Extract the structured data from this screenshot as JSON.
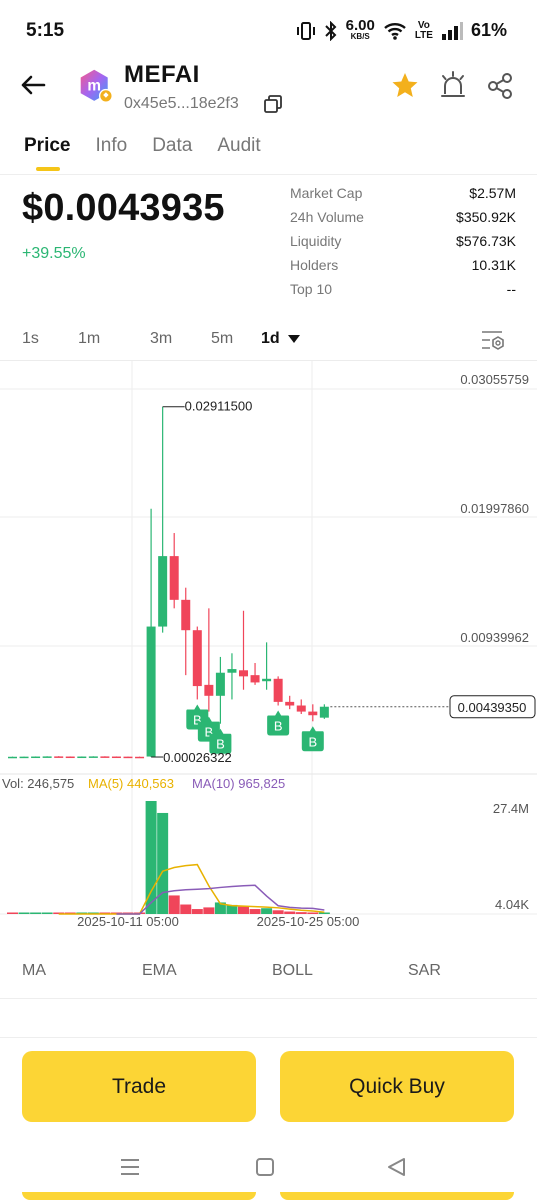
{
  "status_bar": {
    "time": "5:15",
    "net_speed_value": "6.00",
    "net_speed_unit": "KB/S",
    "volte_top": "Vo",
    "volte_bottom": "LTE",
    "battery": "61%"
  },
  "header": {
    "token_name": "MEFAI",
    "address": "0x45e5...18e2f3",
    "icons": [
      "back-arrow-icon",
      "token-logo-icon",
      "copy-icon",
      "star-icon",
      "alert-bell-icon",
      "share-icon"
    ]
  },
  "tabs": [
    {
      "label": "Price",
      "active": true
    },
    {
      "label": "Info",
      "active": false
    },
    {
      "label": "Data",
      "active": false
    },
    {
      "label": "Audit",
      "active": false
    }
  ],
  "price": {
    "value": "$0.0043935",
    "change": "+39.55%"
  },
  "stats": [
    {
      "label": "Market Cap",
      "value": "$2.57M"
    },
    {
      "label": "24h Volume",
      "value": "$350.92K"
    },
    {
      "label": "Liquidity",
      "value": "$576.73K"
    },
    {
      "label": "Holders",
      "value": "10.31K"
    },
    {
      "label": "Top 10",
      "value": "--"
    }
  ],
  "intervals": [
    "1s",
    "1m",
    "3m",
    "5m",
    "1d"
  ],
  "selected_interval": "1d",
  "colors": {
    "up": "#2bb673",
    "down": "#f0455a",
    "accent": "#fcd535",
    "ma5": "#e8b200",
    "ma10": "#8a5cb8"
  },
  "chart_data": {
    "type": "candlestick",
    "price_axis_labels": [
      "0.03055759",
      "0.01997860",
      "0.00939962"
    ],
    "current_price_label": "0.00439350",
    "high_annotation": "0.02911500",
    "low_annotation": "0.00026322",
    "candles": [
      {
        "o": 0.00027,
        "h": 0.00029,
        "l": 0.00026,
        "c": 0.00028
      },
      {
        "o": 0.00028,
        "h": 0.0003,
        "l": 0.00027,
        "c": 0.00029
      },
      {
        "o": 0.00029,
        "h": 0.00031,
        "l": 0.00028,
        "c": 0.0003
      },
      {
        "o": 0.0003,
        "h": 0.00032,
        "l": 0.00029,
        "c": 0.00031
      },
      {
        "o": 0.00031,
        "h": 0.00033,
        "l": 0.0003,
        "c": 0.0003
      },
      {
        "o": 0.0003,
        "h": 0.00031,
        "l": 0.00029,
        "c": 0.00029
      },
      {
        "o": 0.00029,
        "h": 0.00031,
        "l": 0.00028,
        "c": 0.0003
      },
      {
        "o": 0.0003,
        "h": 0.00032,
        "l": 0.00029,
        "c": 0.00031
      },
      {
        "o": 0.00031,
        "h": 0.00032,
        "l": 0.00029,
        "c": 0.0003
      },
      {
        "o": 0.0003,
        "h": 0.00031,
        "l": 0.00028,
        "c": 0.00029
      },
      {
        "o": 0.00029,
        "h": 0.0003,
        "l": 0.00027,
        "c": 0.00028
      },
      {
        "o": 0.00028,
        "h": 0.00029,
        "l": 0.00026,
        "c": 0.00027
      },
      {
        "o": 0.0003,
        "h": 0.0207,
        "l": 0.00026,
        "c": 0.011
      },
      {
        "o": 0.011,
        "h": 0.0291,
        "l": 0.0105,
        "c": 0.0168
      },
      {
        "o": 0.0168,
        "h": 0.0187,
        "l": 0.0125,
        "c": 0.0132
      },
      {
        "o": 0.0132,
        "h": 0.0142,
        "l": 0.007,
        "c": 0.0107
      },
      {
        "o": 0.0107,
        "h": 0.011,
        "l": 0.005,
        "c": 0.0061
      },
      {
        "o": 0.0062,
        "h": 0.0125,
        "l": 0.004,
        "c": 0.0053
      },
      {
        "o": 0.0053,
        "h": 0.0085,
        "l": 0.003,
        "c": 0.0072
      },
      {
        "o": 0.0072,
        "h": 0.0088,
        "l": 0.005,
        "c": 0.0075
      },
      {
        "o": 0.0074,
        "h": 0.0123,
        "l": 0.0058,
        "c": 0.0069
      },
      {
        "o": 0.007,
        "h": 0.008,
        "l": 0.0062,
        "c": 0.0064
      },
      {
        "o": 0.0065,
        "h": 0.0097,
        "l": 0.0058,
        "c": 0.0067
      },
      {
        "o": 0.0067,
        "h": 0.0069,
        "l": 0.0045,
        "c": 0.0048
      },
      {
        "o": 0.0048,
        "h": 0.0053,
        "l": 0.0042,
        "c": 0.0045
      },
      {
        "o": 0.0045,
        "h": 0.005,
        "l": 0.0038,
        "c": 0.004
      },
      {
        "o": 0.004,
        "h": 0.0046,
        "l": 0.0032,
        "c": 0.0037
      },
      {
        "o": 0.0035,
        "h": 0.0046,
        "l": 0.0034,
        "c": 0.0044
      }
    ],
    "buy_markers": [
      {
        "candle": 16,
        "label": "B"
      },
      {
        "candle": 17,
        "label": "B"
      },
      {
        "candle": 18,
        "label": "B"
      },
      {
        "candle": 23,
        "label": "B"
      },
      {
        "candle": 26,
        "label": "B"
      }
    ],
    "volume_legend": {
      "vol": "Vol: 246,575",
      "ma5": "MA(5) 440,563",
      "ma10": "MA(10) 965,825"
    },
    "volume_axis_labels": [
      "27.4M",
      "4.04K"
    ],
    "volume": [
      4040.0,
      4500.0,
      5000.0,
      5000.0,
      4600.0,
      4200.0,
      4400.0,
      4800.0,
      4500.0,
      4300.0,
      4100.0,
      4200.0,
      27400000.0,
      24500000.0,
      4500000.0,
      2300000.0,
      1200000.0,
      1600000.0,
      2800000.0,
      2200000.0,
      1800000.0,
      1200000.0,
      1400000.0,
      900000.0,
      600000.0,
      450000.0,
      350000.0,
      246575.0
    ],
    "volume_colors": [
      "down",
      "up",
      "up",
      "up",
      "down",
      "down",
      "up",
      "up",
      "down",
      "down",
      "down",
      "down",
      "up",
      "up",
      "down",
      "down",
      "down",
      "down",
      "up",
      "up",
      "down",
      "down",
      "up",
      "down",
      "down",
      "down",
      "down",
      "up"
    ],
    "ma5": [
      null,
      null,
      null,
      null,
      4600.0,
      4600.0,
      4700.0,
      4700.0,
      4500.0,
      4400.0,
      4300.0,
      4300.0,
      5480000.0,
      10380000.0,
      11280000.0,
      11740000.0,
      11980000.0,
      6820000.0,
      2480000.0,
      2020000.0,
      1920000.0,
      1800000.0,
      1680000.0,
      1500000.0,
      1190000.0,
      920000.0,
      740000.0,
      440000.0
    ],
    "ma10": [
      null,
      null,
      null,
      null,
      null,
      null,
      null,
      null,
      null,
      4500.0,
      4500.0,
      4500.0,
      2750000.0,
      5200000.0,
      5650000.0,
      5880000.0,
      6000000.0,
      6160000.0,
      6440000.0,
      6660000.0,
      6840000.0,
      6960000.0,
      4360000.0,
      2000000.0,
      1610000.0,
      1430000.0,
      1350000.0,
      966000.0
    ],
    "x_labels": [
      "2025-10-11 05:00",
      "2025-10-25 05:00"
    ]
  },
  "indicator_tabs": [
    "MA",
    "EMA",
    "BOLL",
    "SAR"
  ],
  "buttons": {
    "trade": "Trade",
    "quick_buy": "Quick Buy"
  }
}
